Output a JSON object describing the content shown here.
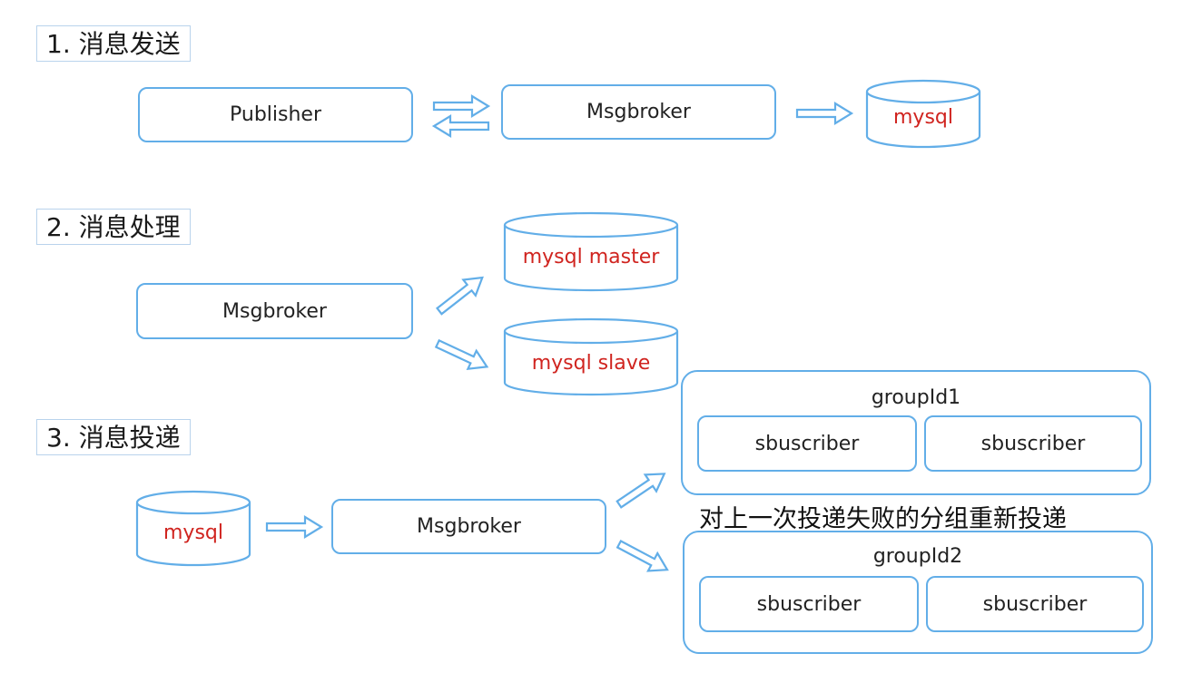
{
  "sections": {
    "send": {
      "title": "1. 消息发送"
    },
    "process": {
      "title": "2. 消息处理"
    },
    "deliver": {
      "title": "3. 消息投递"
    }
  },
  "send": {
    "publisher": "Publisher",
    "broker": "Msgbroker",
    "db": "mysql"
  },
  "process": {
    "broker": "Msgbroker",
    "master": "mysql master",
    "slave": "mysql slave"
  },
  "deliver": {
    "db": "mysql",
    "broker": "Msgbroker",
    "group1": {
      "name": "groupId1",
      "subscribers": [
        "sbuscriber",
        "sbuscriber"
      ]
    },
    "group2": {
      "name": "groupId2",
      "subscribers": [
        "sbuscriber",
        "sbuscriber"
      ]
    },
    "note": "对上一次投递失败的分组重新投递"
  },
  "colors": {
    "accent": "#62aee8",
    "db_text": "#d0241f"
  }
}
